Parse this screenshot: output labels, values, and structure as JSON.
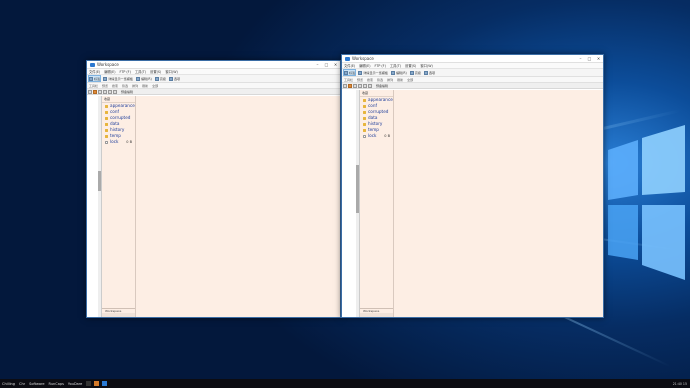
{
  "desktop": {
    "taskbar": {
      "items": [
        "Chilling",
        "Chr",
        "Software",
        "RunCaps",
        "YouDare"
      ],
      "clock": "21:40 15"
    }
  },
  "windows": [
    {
      "title": "Workspace",
      "menu": [
        "文件(E)",
        "编辑(E)",
        "FTP (F)",
        "工具(T)",
        "设置(S)",
        "窗口(W)"
      ],
      "ribbon": [
        "标签",
        "详情显示一览模板",
        "编辑(R)",
        "高级",
        "选项"
      ],
      "ribbon2": [
        "工具栏",
        "预览",
        "搜索",
        "筛选",
        "排列",
        "刷新",
        "全部"
      ],
      "toolstrip_label": "预备编辑",
      "tree_header": "收藏",
      "folders": [
        "appearance",
        "conf",
        "corrupted",
        "data",
        "history",
        "temp",
        "lock"
      ],
      "lock_size": "0 B",
      "footer": "Workspace"
    },
    {
      "title": "Workspace",
      "menu": [
        "文件(E)",
        "编辑(E)",
        "FTP (F)",
        "工具(T)",
        "设置(S)",
        "窗口(W)"
      ],
      "ribbon": [
        "标签",
        "详情显示一览模板",
        "编辑(R)",
        "高级",
        "选项"
      ],
      "ribbon2": [
        "工具栏",
        "预览",
        "搜索",
        "筛选",
        "排列",
        "刷新",
        "全部"
      ],
      "toolstrip_label": "预备编辑",
      "tree_header": "收藏",
      "folders": [
        "appearance",
        "conf",
        "corrupted",
        "data",
        "history",
        "temp",
        "lock"
      ],
      "lock_size": "0 B",
      "footer": "Workspace"
    }
  ]
}
